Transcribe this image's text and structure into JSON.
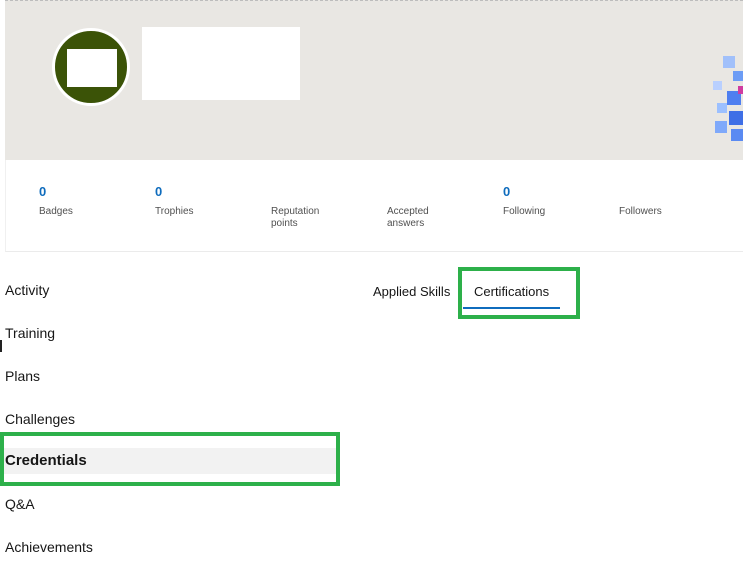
{
  "stats": [
    {
      "value": "0",
      "label": "Badges"
    },
    {
      "value": "0",
      "label": "Trophies"
    },
    {
      "value": "",
      "label": "Reputation points"
    },
    {
      "value": "",
      "label": "Accepted answers"
    },
    {
      "value": "0",
      "label": "Following"
    },
    {
      "value": "",
      "label": "Followers"
    }
  ],
  "sidenav": {
    "items": [
      {
        "label": "Activity"
      },
      {
        "label": "Training"
      },
      {
        "label": "Plans"
      },
      {
        "label": "Challenges"
      },
      {
        "label": "Credentials"
      },
      {
        "label": "Q&A"
      },
      {
        "label": "Achievements"
      }
    ],
    "active": "Credentials"
  },
  "tabs": [
    {
      "label": "Applied Skills"
    },
    {
      "label": "Certifications"
    }
  ],
  "selected_tab": "Certifications",
  "colors": {
    "accent": "#0f6cbd",
    "highlight": "#2db04a",
    "avatar": "#3b5307",
    "banner": "#e9e7e3"
  }
}
